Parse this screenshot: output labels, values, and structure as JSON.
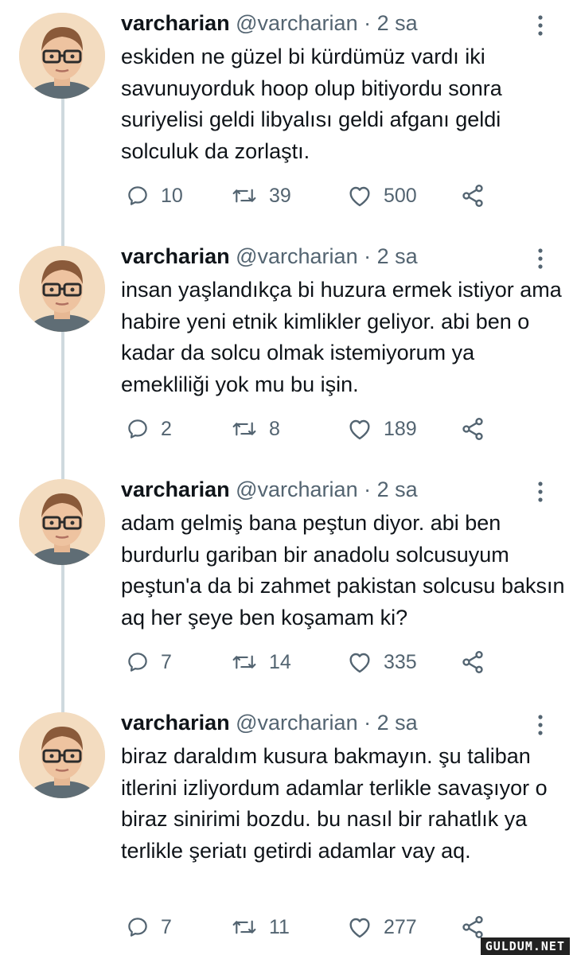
{
  "tweets": [
    {
      "name": "varcharian",
      "handle": "@varcharian",
      "separator": "·",
      "time": "2 sa",
      "text": "eskiden ne güzel bi kürdümüz vardı iki savunuyorduk hoop olup bitiyordu sonra suriyelisi geldi libyalısı geldi afganı geldi solculuk da zorlaştı.",
      "replies": "10",
      "retweets": "39",
      "likes": "500"
    },
    {
      "name": "varcharian",
      "handle": "@varcharian",
      "separator": "·",
      "time": "2 sa",
      "text": "insan yaşlandıkça bi huzura ermek istiyor ama habire yeni etnik kimlikler geliyor. abi ben o kadar da solcu olmak istemiyorum ya emekliliği yok mu bu işin.",
      "replies": "2",
      "retweets": "8",
      "likes": "189"
    },
    {
      "name": "varcharian",
      "handle": "@varcharian",
      "separator": "·",
      "time": "2 sa",
      "text": "adam gelmiş bana peştun diyor. abi ben burdurlu gariban bir anadolu solcusuyum peştun'a da bi zahmet pakistan solcusu baksın aq her şeye ben koşamam ki?",
      "replies": "7",
      "retweets": "14",
      "likes": "335"
    },
    {
      "name": "varcharian",
      "handle": "@varcharian",
      "separator": "·",
      "time": "2 sa",
      "text": "biraz daraldım kusura bakmayın. şu taliban itlerini izliyordum adamlar terlikle savaşıyor o biraz sinirimi bozdu. bu nasıl bir rahatlık ya terlikle şeriatı getirdi adamlar vay aq.",
      "replies": "7",
      "retweets": "11",
      "likes": "277"
    }
  ],
  "icons": {
    "reply": "reply-icon",
    "retweet": "retweet-icon",
    "like": "heart-icon",
    "share": "share-icon",
    "more": "more-options-icon"
  },
  "colors": {
    "text": "#0f1419",
    "secondary": "#536471",
    "thread_line": "#cfd9de"
  },
  "watermark": "GULDUM.NET"
}
